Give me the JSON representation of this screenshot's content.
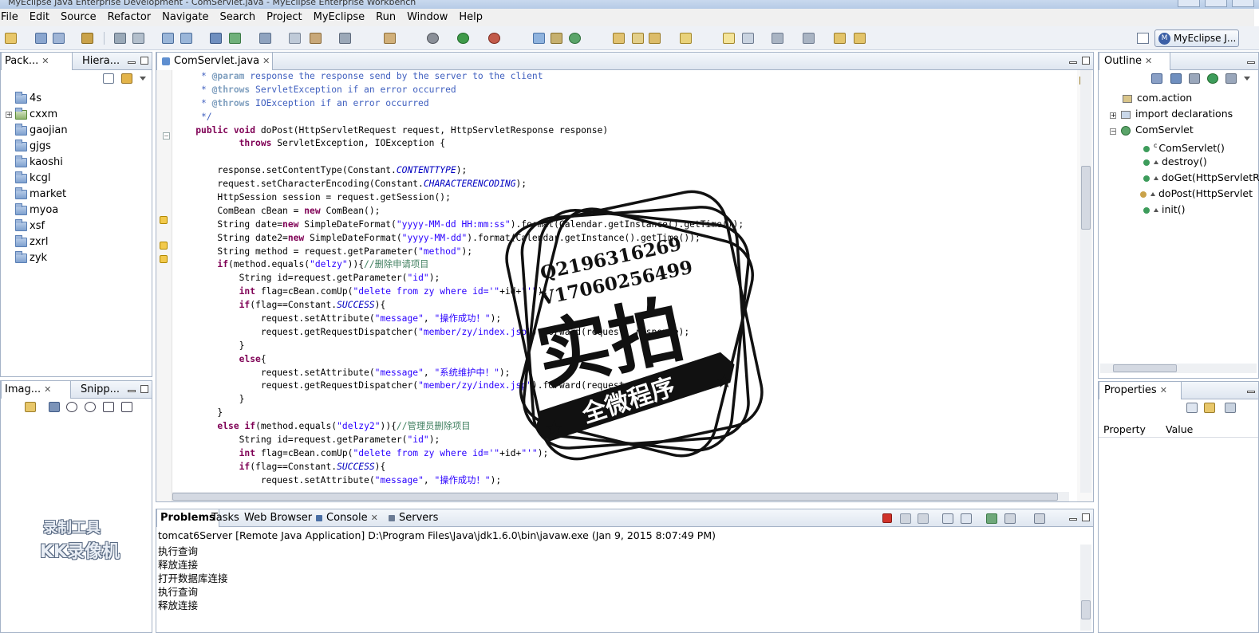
{
  "window": {
    "title": "MyEclipse Java Enterprise Development - ComServlet.java - MyEclipse Enterprise Workbench"
  },
  "menu": [
    "File",
    "Edit",
    "Source",
    "Refactor",
    "Navigate",
    "Search",
    "Project",
    "MyEclipse",
    "Run",
    "Window",
    "Help"
  ],
  "perspective": {
    "label": "MyEclipse J..."
  },
  "package_explorer": {
    "tabs": [
      {
        "label": "Pack..."
      },
      {
        "label": "Hiera..."
      }
    ],
    "projects": [
      "4s",
      "cxxm",
      "gaojian",
      "gjgs",
      "kaoshi",
      "kcgl",
      "market",
      "myoa",
      "xsf",
      "zxrl",
      "zyk"
    ]
  },
  "image_view": {
    "tabs": [
      {
        "label": "Imag..."
      },
      {
        "label": "Snipp..."
      }
    ]
  },
  "editor": {
    "tab": "ComServlet.java",
    "lines": [
      "     * @param response the response send by the server to the client",
      "     * @throws ServletException if an error occurred",
      "     * @throws IOException if an error occurred",
      "     */",
      "    public void doPost(HttpServletRequest request, HttpServletResponse response)",
      "            throws ServletException, IOException {",
      "",
      "        response.setContentType(Constant.CONTENTTYPE);",
      "        request.setCharacterEncoding(Constant.CHARACTERENCODING);",
      "        HttpSession session = request.getSession();",
      "        ComBean cBean = new ComBean();",
      "        String date=new SimpleDateFormat(\"yyyy-MM-dd HH:mm:ss\").format(Calendar.getInstance().getTime());",
      "        String date2=new SimpleDateFormat(\"yyyy-MM-dd\").format(Calendar.getInstance().getTime());",
      "        String method = request.getParameter(\"method\");",
      "        if(method.equals(\"delzy\")){//删除申请项目",
      "            String id=request.getParameter(\"id\");",
      "            int flag=cBean.comUp(\"delete from zy where id='\"+id+\"'\");",
      "            if(flag==Constant.SUCCESS){",
      "                request.setAttribute(\"message\", \"操作成功！\");",
      "                request.getRequestDispatcher(\"member/zy/index.jsp\").forward(request, response);",
      "            }",
      "            else{",
      "                request.setAttribute(\"message\", \"系统维护中！\");",
      "                request.getRequestDispatcher(\"member/zy/index.jsp\").forward(request, response);",
      "            }",
      "        }",
      "        else if(method.equals(\"delzy2\")){//管理员删除项目",
      "            String id=request.getParameter(\"id\");",
      "            int flag=cBean.comUp(\"delete from zy where id='\"+id+\"'\");",
      "            if(flag==Constant.SUCCESS){",
      "                request.setAttribute(\"message\", \"操作成功！\");"
    ]
  },
  "outline": {
    "tab": "Outline",
    "items": [
      {
        "label": "com.action",
        "kind": "package"
      },
      {
        "label": "import declarations",
        "kind": "imports"
      },
      {
        "label": "ComServlet",
        "kind": "class"
      },
      {
        "label": "ComServlet()",
        "kind": "constructor"
      },
      {
        "label": "destroy()",
        "kind": "method"
      },
      {
        "label": "doGet(HttpServletR",
        "kind": "method"
      },
      {
        "label": "doPost(HttpServlet",
        "kind": "method"
      },
      {
        "label": "init()",
        "kind": "method"
      }
    ]
  },
  "properties": {
    "tab": "Properties",
    "col_property": "Property",
    "col_value": "Value"
  },
  "bottom": {
    "tabs": [
      {
        "label": "Problems"
      },
      {
        "label": "Tasks"
      },
      {
        "label": "Web Browser"
      },
      {
        "label": "Console"
      },
      {
        "label": "Servers"
      }
    ],
    "console_header": "tomcat6Server [Remote Java Application] D:\\Program Files\\Java\\jdk1.6.0\\bin\\javaw.exe (Jan 9, 2015 8:07:49 PM)",
    "console_lines": [
      "执行查询",
      "释放连接",
      "打开数据库连接",
      "执行查询",
      "释放连接"
    ]
  },
  "watermark": {
    "line1": "Q2196316269",
    "line2": "V17060256499",
    "big": "实拍",
    "banner": "全微程序"
  },
  "recorder_logo": {
    "line1": "录制工具",
    "line2": "KK录像机"
  }
}
